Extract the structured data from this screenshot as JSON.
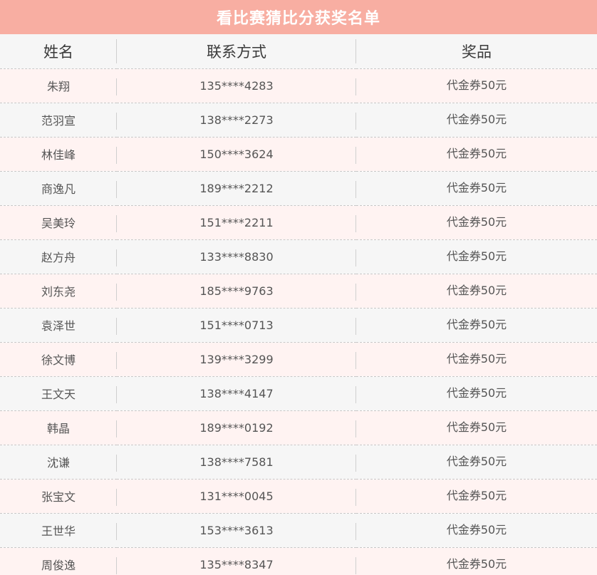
{
  "title": "看比赛猜比分获奖名单",
  "columns": {
    "name": "姓名",
    "contact": "联系方式",
    "prize": "奖品"
  },
  "rows": [
    {
      "name": "朱翔",
      "contact": "135****4283",
      "prize": "代金券50元"
    },
    {
      "name": "范羽宣",
      "contact": "138****2273",
      "prize": "代金券50元"
    },
    {
      "name": "林佳峰",
      "contact": "150****3624",
      "prize": "代金券50元"
    },
    {
      "name": "商逸凡",
      "contact": "189****2212",
      "prize": "代金券50元"
    },
    {
      "name": "吴美玲",
      "contact": "151****2211",
      "prize": "代金券50元"
    },
    {
      "name": "赵方舟",
      "contact": "133****8830",
      "prize": "代金券50元"
    },
    {
      "name": "刘东尧",
      "contact": "185****9763",
      "prize": "代金券50元"
    },
    {
      "name": "袁泽世",
      "contact": "151****0713",
      "prize": "代金券50元"
    },
    {
      "name": "徐文博",
      "contact": "139****3299",
      "prize": "代金券50元"
    },
    {
      "name": "王文天",
      "contact": "138****4147",
      "prize": "代金券50元"
    },
    {
      "name": "韩晶",
      "contact": "189****0192",
      "prize": "代金券50元"
    },
    {
      "name": "沈谦",
      "contact": "138****7581",
      "prize": "代金券50元"
    },
    {
      "name": "张宝文",
      "contact": "131****0045",
      "prize": "代金券50元"
    },
    {
      "name": "王世华",
      "contact": "153****3613",
      "prize": "代金券50元"
    },
    {
      "name": "周俊逸",
      "contact": "135****8347",
      "prize": "代金券50元"
    }
  ]
}
